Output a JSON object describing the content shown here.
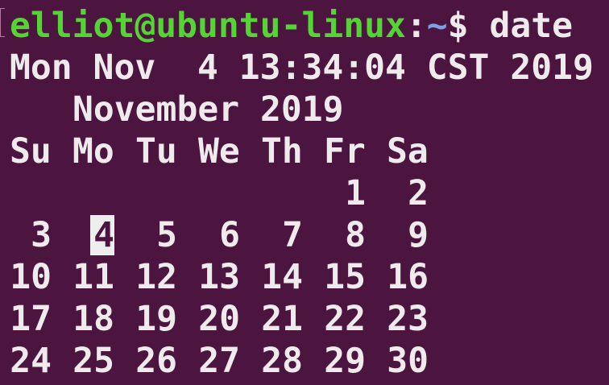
{
  "prompt": {
    "user_host": "elliot@ubuntu-linux",
    "separator": ":",
    "path": "~",
    "sign": "$",
    "command": "date"
  },
  "output_date": "Mon Nov  4 13:34:04 CST 2019",
  "calendar": {
    "title": "November 2019",
    "weekdays": [
      "Su",
      "Mo",
      "Tu",
      "We",
      "Th",
      "Fr",
      "Sa"
    ],
    "weeks": [
      [
        "",
        "",
        "",
        "",
        "",
        "1",
        "2"
      ],
      [
        "3",
        "4",
        "5",
        "6",
        "7",
        "8",
        "9"
      ],
      [
        "10",
        "11",
        "12",
        "13",
        "14",
        "15",
        "16"
      ],
      [
        "17",
        "18",
        "19",
        "20",
        "21",
        "22",
        "23"
      ],
      [
        "24",
        "25",
        "26",
        "27",
        "28",
        "29",
        "30"
      ]
    ],
    "today": "4"
  },
  "colors": {
    "background": "#4b1540",
    "prompt_user": "#55d436",
    "prompt_path": "#7d9fe6",
    "text": "#efeaeb",
    "highlight": "#eeeeee"
  }
}
